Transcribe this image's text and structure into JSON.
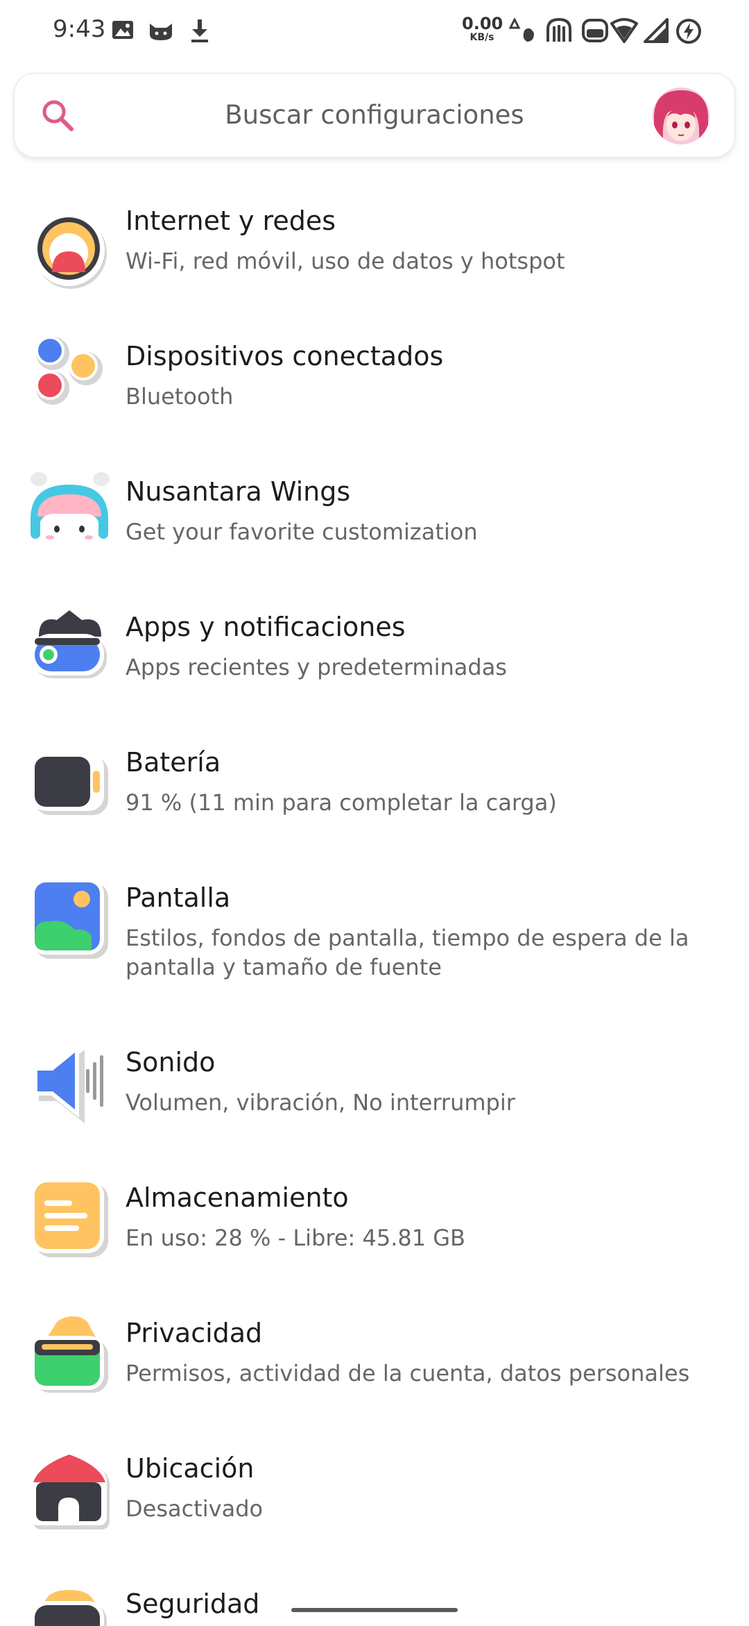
{
  "status_bar": {
    "time": "9:43",
    "net_speed_value": "0.00",
    "net_speed_unit": "KB/s",
    "left_icons": [
      "image-icon",
      "cat-icon",
      "download-icon"
    ],
    "right_icons": [
      "data-icon",
      "vibrate-icon",
      "mute-icon",
      "wifi-icon",
      "signal-icon",
      "battery-charging-icon"
    ]
  },
  "search": {
    "placeholder": "Buscar configuraciones",
    "icon": "search-icon",
    "accent_color": "#e05a86"
  },
  "settings": [
    {
      "title": "Internet y redes",
      "subtitle": "Wi-Fi, red móvil, uso de datos y hotspot",
      "icon": "network-icon"
    },
    {
      "title": "Dispositivos conectados",
      "subtitle": "Bluetooth",
      "icon": "devices-icon"
    },
    {
      "title": "Nusantara Wings",
      "subtitle": "Get your favorite customization",
      "icon": "wings-icon"
    },
    {
      "title": "Apps y notificaciones",
      "subtitle": "Apps recientes y predeterminadas",
      "icon": "apps-icon"
    },
    {
      "title": "Batería",
      "subtitle": "91 % (11 min para completar la carga)",
      "icon": "battery-icon"
    },
    {
      "title": "Pantalla",
      "subtitle": "Estilos, fondos de pantalla, tiempo de espera de la pantalla y tamaño de fuente",
      "icon": "display-icon"
    },
    {
      "title": "Sonido",
      "subtitle": "Volumen, vibración, No interrumpir",
      "icon": "sound-icon"
    },
    {
      "title": "Almacenamiento",
      "subtitle": "En uso: 28 % - Libre: 45.81 GB",
      "icon": "storage-icon"
    },
    {
      "title": "Privacidad",
      "subtitle": "Permisos, actividad de la cuenta, datos personales",
      "icon": "privacy-icon"
    },
    {
      "title": "Ubicación",
      "subtitle": "Desactivado",
      "icon": "location-icon"
    },
    {
      "title": "Seguridad",
      "subtitle": "",
      "icon": "security-icon"
    }
  ]
}
